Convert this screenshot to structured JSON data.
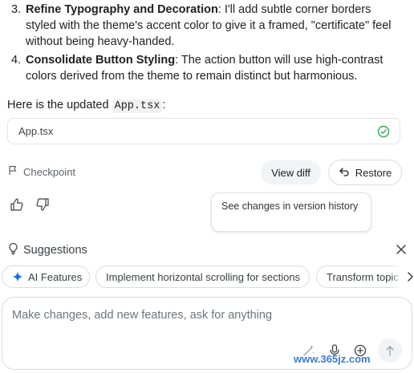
{
  "steps": [
    {
      "num": "3.",
      "title": "Refine Typography and Decoration",
      "text": ": I'll add subtle corner borders styled with the theme's accent color to give it a framed, \"certificate\" feel without being heavy-handed."
    },
    {
      "num": "4.",
      "title": "Consolidate Button Styling",
      "text": ": The action button will use high-contrast colors derived from the theme to remain distinct but harmonious."
    }
  ],
  "intro": {
    "prefix": "Here is the updated ",
    "code": "App.tsx",
    "suffix": ":"
  },
  "file_card": {
    "name": "App.tsx",
    "status_icon": "check-circle-icon",
    "status_color": "#34a853"
  },
  "checkpoint": {
    "label": "Checkpoint",
    "icon": "flag-icon"
  },
  "actions": {
    "view_diff": "View diff",
    "restore": "Restore",
    "restore_icon": "undo-icon"
  },
  "feedback": {
    "like_icon": "thumbs-up-icon",
    "dislike_icon": "thumbs-down-icon"
  },
  "tooltip": {
    "text": "See changes in version history"
  },
  "suggestions": {
    "title": "Suggestions",
    "icon": "lightbulb-icon",
    "close_icon": "close-icon",
    "chips": [
      {
        "label": "AI Features",
        "icon": "sparkle-icon",
        "accent": "#1a73e8"
      },
      {
        "label": "Implement horizontal scrolling for sections"
      },
      {
        "label": "Transform topic"
      }
    ],
    "scroll_icon": "chevron-right-icon"
  },
  "composer": {
    "placeholder": "Make changes, add new features, ask for anything",
    "tools": [
      "magic-wand-icon",
      "microphone-icon",
      "add-circle-icon"
    ],
    "send_icon": "arrow-up-icon"
  },
  "watermark": {
    "text": "www.365jz.com"
  }
}
